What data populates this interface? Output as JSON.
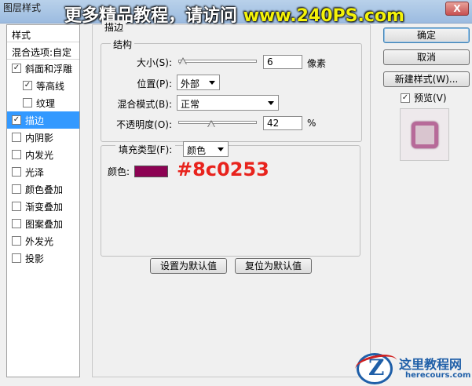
{
  "window": {
    "title": "图层样式",
    "banner_cn": "更多精品教程，请访问",
    "banner_url": "www.240PS.com",
    "close_label": "X"
  },
  "styles_panel": {
    "header": "样式",
    "blend_options": "混合选项:自定",
    "effects": [
      {
        "label": "斜面和浮雕",
        "checked": true,
        "indent": false,
        "selected": false
      },
      {
        "label": "等高线",
        "checked": true,
        "indent": true,
        "selected": false
      },
      {
        "label": "纹理",
        "checked": false,
        "indent": true,
        "selected": false
      },
      {
        "label": "描边",
        "checked": true,
        "indent": false,
        "selected": true
      },
      {
        "label": "内阴影",
        "checked": false,
        "indent": false,
        "selected": false
      },
      {
        "label": "内发光",
        "checked": false,
        "indent": false,
        "selected": false
      },
      {
        "label": "光泽",
        "checked": false,
        "indent": false,
        "selected": false
      },
      {
        "label": "颜色叠加",
        "checked": false,
        "indent": false,
        "selected": false
      },
      {
        "label": "渐变叠加",
        "checked": false,
        "indent": false,
        "selected": false
      },
      {
        "label": "图案叠加",
        "checked": false,
        "indent": false,
        "selected": false
      },
      {
        "label": "外发光",
        "checked": false,
        "indent": false,
        "selected": false
      },
      {
        "label": "投影",
        "checked": false,
        "indent": false,
        "selected": false
      }
    ]
  },
  "stroke": {
    "section_title": "描边",
    "structure_title": "结构",
    "size": {
      "label": "大小(S):",
      "value": "6",
      "unit": "像素",
      "slider_fraction": 0.06
    },
    "position": {
      "label": "位置(P):",
      "value": "外部"
    },
    "blend_mode": {
      "label": "混合模式(B):",
      "value": "正常"
    },
    "opacity": {
      "label": "不透明度(O):",
      "value": "42",
      "unit": "%",
      "slider_fraction": 0.42
    },
    "fill_type": {
      "label": "填充类型(F):",
      "value": "颜色"
    },
    "color": {
      "label": "颜色:",
      "hex": "#8c0253",
      "hex_annotation": "#8c0253"
    },
    "make_default_label": "设置为默认值",
    "reset_default_label": "复位为默认值"
  },
  "right_buttons": {
    "ok": "确定",
    "cancel": "取消",
    "new_style": "新建样式(W)...",
    "preview_label": "预览(V)",
    "preview_checked": true
  },
  "watermark": {
    "title": "这里教程网",
    "url": "herecours.com"
  }
}
